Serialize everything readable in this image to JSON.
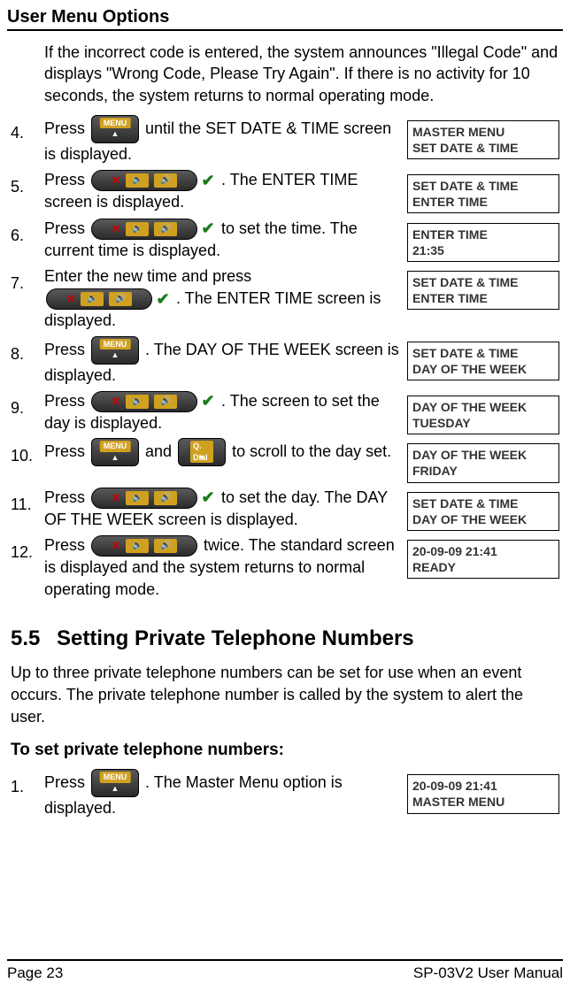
{
  "header": "User Menu Options",
  "intro": "If the incorrect code is entered, the system announces \"Illegal Code\" and displays \"Wrong Code, Please Try Again\". If there is no activity for 10 seconds, the system returns to normal operating mode.",
  "steps": [
    {
      "pre": "Press ",
      "btn": "menu",
      "post": " until the SET DATE & TIME screen is displayed.",
      "lcd1": "MASTER MENU",
      "lcd2": "SET DATE & TIME"
    },
    {
      "pre": "Press ",
      "btn": "confirm",
      "post": ". The ENTER TIME screen is displayed.",
      "lcd1": "SET DATE & TIME",
      "lcd2": "ENTER TIME"
    },
    {
      "pre": "Press ",
      "btn": "confirm",
      "post": " to set the time. The current time is displayed.",
      "lcd1": "ENTER TIME",
      "lcd2": "21:35"
    },
    {
      "pre": "Enter the new time and press ",
      "btn": "confirm-inline",
      "post": ". The ENTER TIME screen is displayed.",
      "lcd1": "SET DATE & TIME",
      "lcd2": "ENTER TIME"
    },
    {
      "pre": "Press ",
      "btn": "menu",
      "post": ". The DAY OF THE WEEK screen is displayed.",
      "lcd1": "SET DATE & TIME",
      "lcd2": "DAY OF THE WEEK"
    },
    {
      "pre": "Press ",
      "btn": "confirm",
      "post": ". The screen to set the day is displayed.",
      "lcd1": "DAY OF THE WEEK",
      "lcd2": "TUESDAY"
    },
    {
      "pre": "Press ",
      "btn": "menu-qdial",
      "mid": " and ",
      "post": " to scroll to the day set.",
      "lcd1": "DAY OF THE WEEK",
      "lcd2": "FRIDAY"
    },
    {
      "pre": "Press ",
      "btn": "confirm",
      "post": " to set the day. The DAY OF THE WEEK screen is displayed.",
      "lcd1": "SET DATE & TIME",
      "lcd2": "DAY OF THE WEEK"
    },
    {
      "pre": "Press ",
      "btn": "cancel",
      "post": " twice. The standard screen is displayed and the system returns to normal operating mode.",
      "lcd1": "20-09-09  21:41",
      "lcd2": "READY"
    }
  ],
  "section": {
    "num": "5.5",
    "title": "Setting Private Telephone Numbers"
  },
  "section_body": "Up to three private telephone numbers can be set for use when an event occurs. The private telephone number is called by the system to alert the user.",
  "subhead": "To set private telephone numbers:",
  "steps2": [
    {
      "pre": "Press ",
      "btn": "menu",
      "post": ". The Master Menu option is displayed.",
      "lcd1": "20-09-09 21:41",
      "lcd2": "MASTER MENU"
    }
  ],
  "footer": {
    "left": "Page 23",
    "right": "SP-03V2 User Manual"
  }
}
